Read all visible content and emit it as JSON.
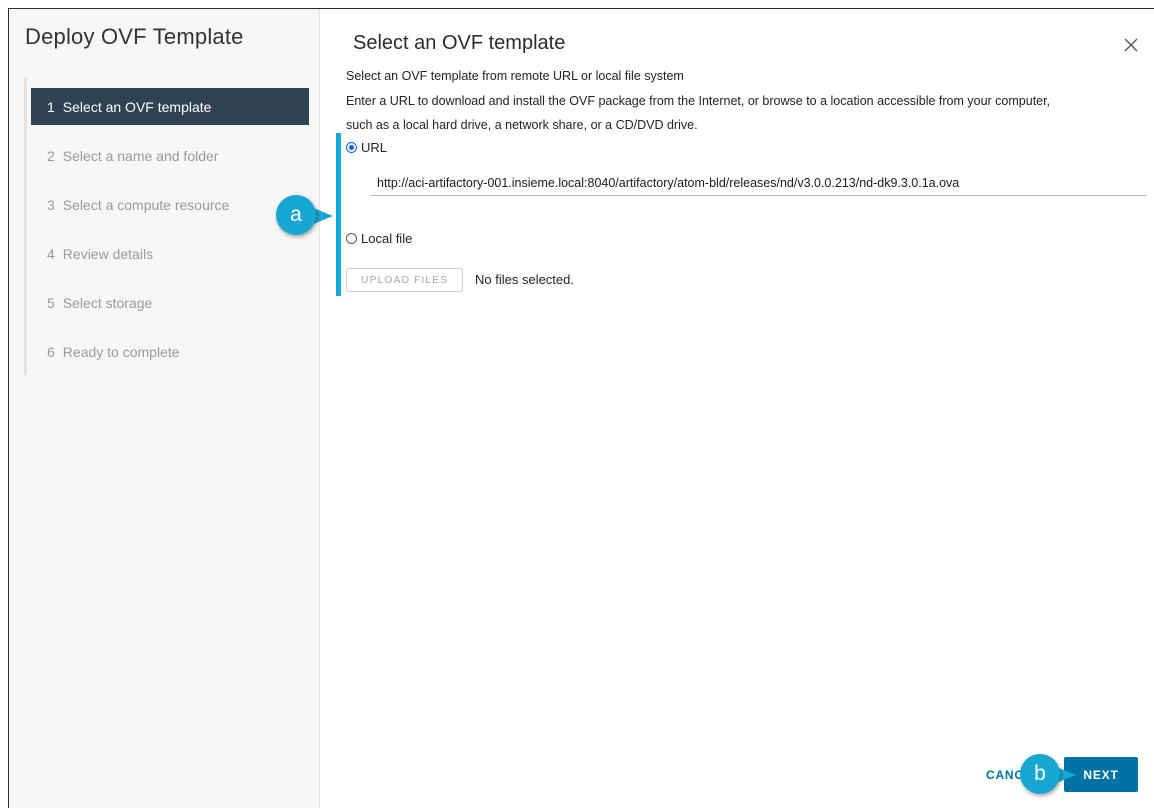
{
  "sidebar": {
    "title": "Deploy OVF Template",
    "steps": [
      {
        "num": "1",
        "label": "Select an OVF template"
      },
      {
        "num": "2",
        "label": "Select a name and folder"
      },
      {
        "num": "3",
        "label": "Select a compute resource"
      },
      {
        "num": "4",
        "label": "Review details"
      },
      {
        "num": "5",
        "label": "Select storage"
      },
      {
        "num": "6",
        "label": "Ready to complete"
      }
    ],
    "active_step": 1
  },
  "main": {
    "title": "Select an OVF template",
    "subtitle": "Select an OVF template from remote URL or local file system",
    "description_line1": "Enter a URL to download and install the OVF package from the Internet, or browse to a location accessible from your computer,",
    "description_line2": "such as a local hard drive, a network share, or a CD/DVD drive.",
    "url_option_label": "URL",
    "url_value": "http://aci-artifactory-001.insieme.local:8040/artifactory/atom-bld/releases/nd/v3.0.0.213/nd-dk9.3.0.1a.ova",
    "local_file_option_label": "Local file",
    "upload_button_label": "UPLOAD FILES",
    "no_files_text": "No files selected.",
    "selected_source": "URL"
  },
  "footer": {
    "cancel_label": "CANCEL",
    "next_label": "NEXT"
  },
  "callouts": {
    "a": "a",
    "b": "b"
  },
  "colors": {
    "active_step_bg": "#2f4352",
    "primary_button": "#0072a3",
    "callout": "#18a6d2",
    "radio_selected": "#0b63d6"
  }
}
